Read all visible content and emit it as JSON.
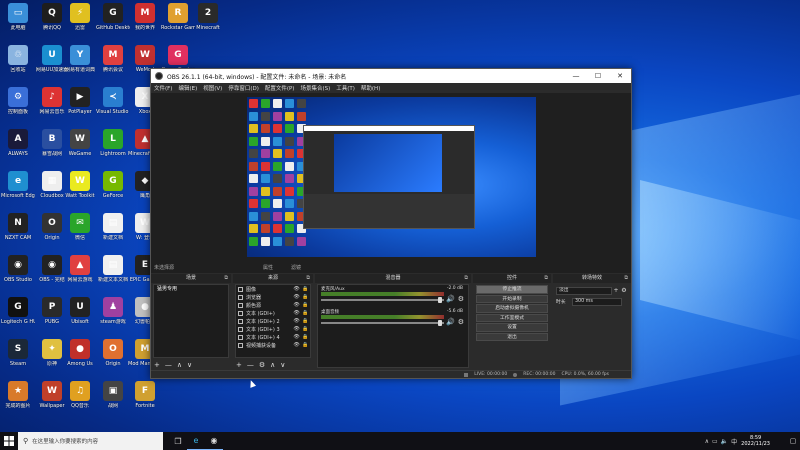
{
  "desktop": {
    "columns": [
      {
        "icons": [
          {
            "label": "此电脑",
            "color": "#3a8fd8",
            "glyph": "▭"
          },
          {
            "label": "回收站",
            "color": "#8ab4e0",
            "glyph": "♲"
          },
          {
            "label": "控制面板",
            "color": "#3a6fd8",
            "glyph": "⚙"
          },
          {
            "label": "ALWAYS",
            "color": "#1a1a3a",
            "glyph": "A"
          },
          {
            "label": "Microsoft Edge",
            "color": "#1f8fd0",
            "glyph": "e"
          },
          {
            "label": "NZXT CAM",
            "color": "#222",
            "glyph": "N"
          },
          {
            "label": "OBS Studio",
            "color": "#222",
            "glyph": "◉"
          },
          {
            "label": "Logitech G HUB",
            "color": "#111",
            "glyph": "G"
          },
          {
            "label": "Steam",
            "color": "#1b2838",
            "glyph": "S"
          },
          {
            "label": "完成的图片",
            "color": "#d87a2a",
            "glyph": "★"
          }
        ]
      },
      {
        "icons": [
          {
            "label": "腾讯QQ",
            "color": "#1e1e1e",
            "glyph": "Q"
          },
          {
            "label": "网易UU加速器",
            "color": "#1a8fd0",
            "glyph": "U"
          },
          {
            "label": "网易云音乐",
            "color": "#d33",
            "glyph": "♪"
          },
          {
            "label": "暴雪战网",
            "color": "#2a4fa0",
            "glyph": "B"
          },
          {
            "label": "Cloudbox",
            "color": "#eee",
            "glyph": "▦"
          },
          {
            "label": "Origin",
            "color": "#333",
            "glyph": "O"
          },
          {
            "label": "OBS - 完结",
            "color": "#222",
            "glyph": "◉"
          },
          {
            "label": "PUBG",
            "color": "#2a2a2a",
            "glyph": "P"
          },
          {
            "label": "原神",
            "color": "#e0c040",
            "glyph": "✦"
          },
          {
            "label": "Wallpaper",
            "color": "#c0402a",
            "glyph": "W"
          }
        ]
      },
      {
        "icons": [
          {
            "label": "迅雷",
            "color": "#e0c020",
            "glyph": "⚡"
          },
          {
            "label": "网易有道词典",
            "color": "#3a8fd8",
            "glyph": "Y"
          },
          {
            "label": "PotPlayer",
            "color": "#222",
            "glyph": "▶"
          },
          {
            "label": "WeGame",
            "color": "#444",
            "glyph": "W"
          },
          {
            "label": "Watt Toolkit",
            "color": "#eaea20",
            "glyph": "W"
          },
          {
            "label": "微信",
            "color": "#2aa52a",
            "glyph": "✉"
          },
          {
            "label": "网易云游戏",
            "color": "#e04040",
            "glyph": "▲"
          },
          {
            "label": "Ubisoft",
            "color": "#222",
            "glyph": "U"
          },
          {
            "label": "Among Us",
            "color": "#c0302a",
            "glyph": "●"
          },
          {
            "label": "QQ音乐",
            "color": "#e0a020",
            "glyph": "♫"
          }
        ]
      },
      {
        "icons": [
          {
            "label": "GitHub Desktop",
            "color": "#222",
            "glyph": "G"
          },
          {
            "label": "腾讯会议",
            "color": "#e04040",
            "glyph": "M"
          },
          {
            "label": "Visual Studio Code",
            "color": "#2a7fd0",
            "glyph": "≺"
          },
          {
            "label": "Lightroom",
            "color": "#2aa52a",
            "glyph": "L"
          },
          {
            "label": "GeForce",
            "color": "#76b900",
            "glyph": "G"
          },
          {
            "label": "新建文档",
            "color": "#f0f0f0",
            "glyph": "▤"
          },
          {
            "label": "新建文本文档",
            "color": "#f0f0f0",
            "glyph": "▤"
          },
          {
            "label": "steam游戏",
            "color": "#a040a0",
            "glyph": "♟"
          },
          {
            "label": "Origin",
            "color": "#e07030",
            "glyph": "O"
          },
          {
            "label": "战网",
            "color": "#444",
            "glyph": "▣"
          }
        ]
      },
      {
        "icons": [
          {
            "label": "我的世界",
            "color": "#d03030",
            "glyph": "M"
          },
          {
            "label": "WeMod",
            "color": "#c03030",
            "glyph": "W"
          },
          {
            "label": "Xbox",
            "color": "#eee",
            "glyph": "X"
          },
          {
            "label": "Minecraft Launcher",
            "color": "#c03030",
            "glyph": "▲"
          },
          {
            "label": "鹰角",
            "color": "#222",
            "glyph": "◆"
          },
          {
            "label": "W: 登录",
            "color": "#eee",
            "glyph": "W"
          },
          {
            "label": "EPIC Games",
            "color": "#222",
            "glyph": "E"
          },
          {
            "label": "幻兽帕鲁",
            "color": "#c0c0c0",
            "glyph": "●"
          },
          {
            "label": "Mod Manager",
            "color": "#d0a030",
            "glyph": "M"
          },
          {
            "label": "Fortnite",
            "color": "#d0a030",
            "glyph": "F"
          }
        ]
      },
      {
        "icons": [
          {
            "label": "Rockstar Games",
            "color": "#e0a030",
            "glyph": "R"
          },
          {
            "label": "Game Center",
            "color": "#e03060",
            "glyph": "G"
          },
          {
            "label": "",
            "color": "transparent",
            "glyph": ""
          }
        ]
      },
      {
        "icons": [
          {
            "label": "Minecraft",
            "color": "#2a2a2a",
            "glyph": "2"
          }
        ]
      }
    ]
  },
  "obs": {
    "title": "OBS 26.1.1 (64-bit, windows) - 配置文件: 未命名 - 场景: 未命名",
    "window_buttons": [
      "—",
      "☐",
      "✕"
    ],
    "menu": [
      "文件(F)",
      "编辑(E)",
      "视图(V)",
      "停靠窗口(D)",
      "配置文件(P)",
      "场景集合(S)",
      "工具(T)",
      "帮助(H)"
    ],
    "source_toolbar": {
      "no_source": "未选择源",
      "properties": "属性",
      "filters": "滤镜"
    },
    "scenes": {
      "title": "场景",
      "items": [
        "猛男专用"
      ],
      "footer": [
        "+",
        "—",
        "∧",
        "∨"
      ]
    },
    "sources": {
      "title": "来源",
      "items": [
        {
          "name": "图像"
        },
        {
          "name": "浏览器"
        },
        {
          "name": "颜色源"
        },
        {
          "name": "文本 (GDI+)"
        },
        {
          "name": "文本 (GDI+) 2"
        },
        {
          "name": "文本 (GDI+) 3"
        },
        {
          "name": "文本 (GDI+) 4"
        },
        {
          "name": "视频捕获设备"
        }
      ],
      "footer": [
        "+",
        "—",
        "⚙",
        "∧",
        "∨"
      ]
    },
    "mixer": {
      "title": "混音器",
      "channels": [
        {
          "name": "麦克风/Aux",
          "db": "-2.0 dB"
        },
        {
          "name": "桌面音频",
          "db": "-5.6 dB"
        }
      ]
    },
    "controls": {
      "title": "控件",
      "buttons": [
        "停止推流",
        "开始录制",
        "启动虚拟摄像机",
        "工作室模式",
        "设置",
        "退出"
      ]
    },
    "transitions": {
      "title": "转场特效",
      "type": "淡出",
      "duration_label": "时长",
      "duration_value": "300 ms"
    },
    "status": {
      "live": "LIVE: 00:00:00",
      "rec": "REC: 00:00:00",
      "cpu": "CPU: 0.0%, 60.00 fps"
    }
  },
  "taskbar": {
    "search_placeholder": "在这里输入你要搜索的内容",
    "time": "8:59",
    "date": "2022/11/23"
  }
}
